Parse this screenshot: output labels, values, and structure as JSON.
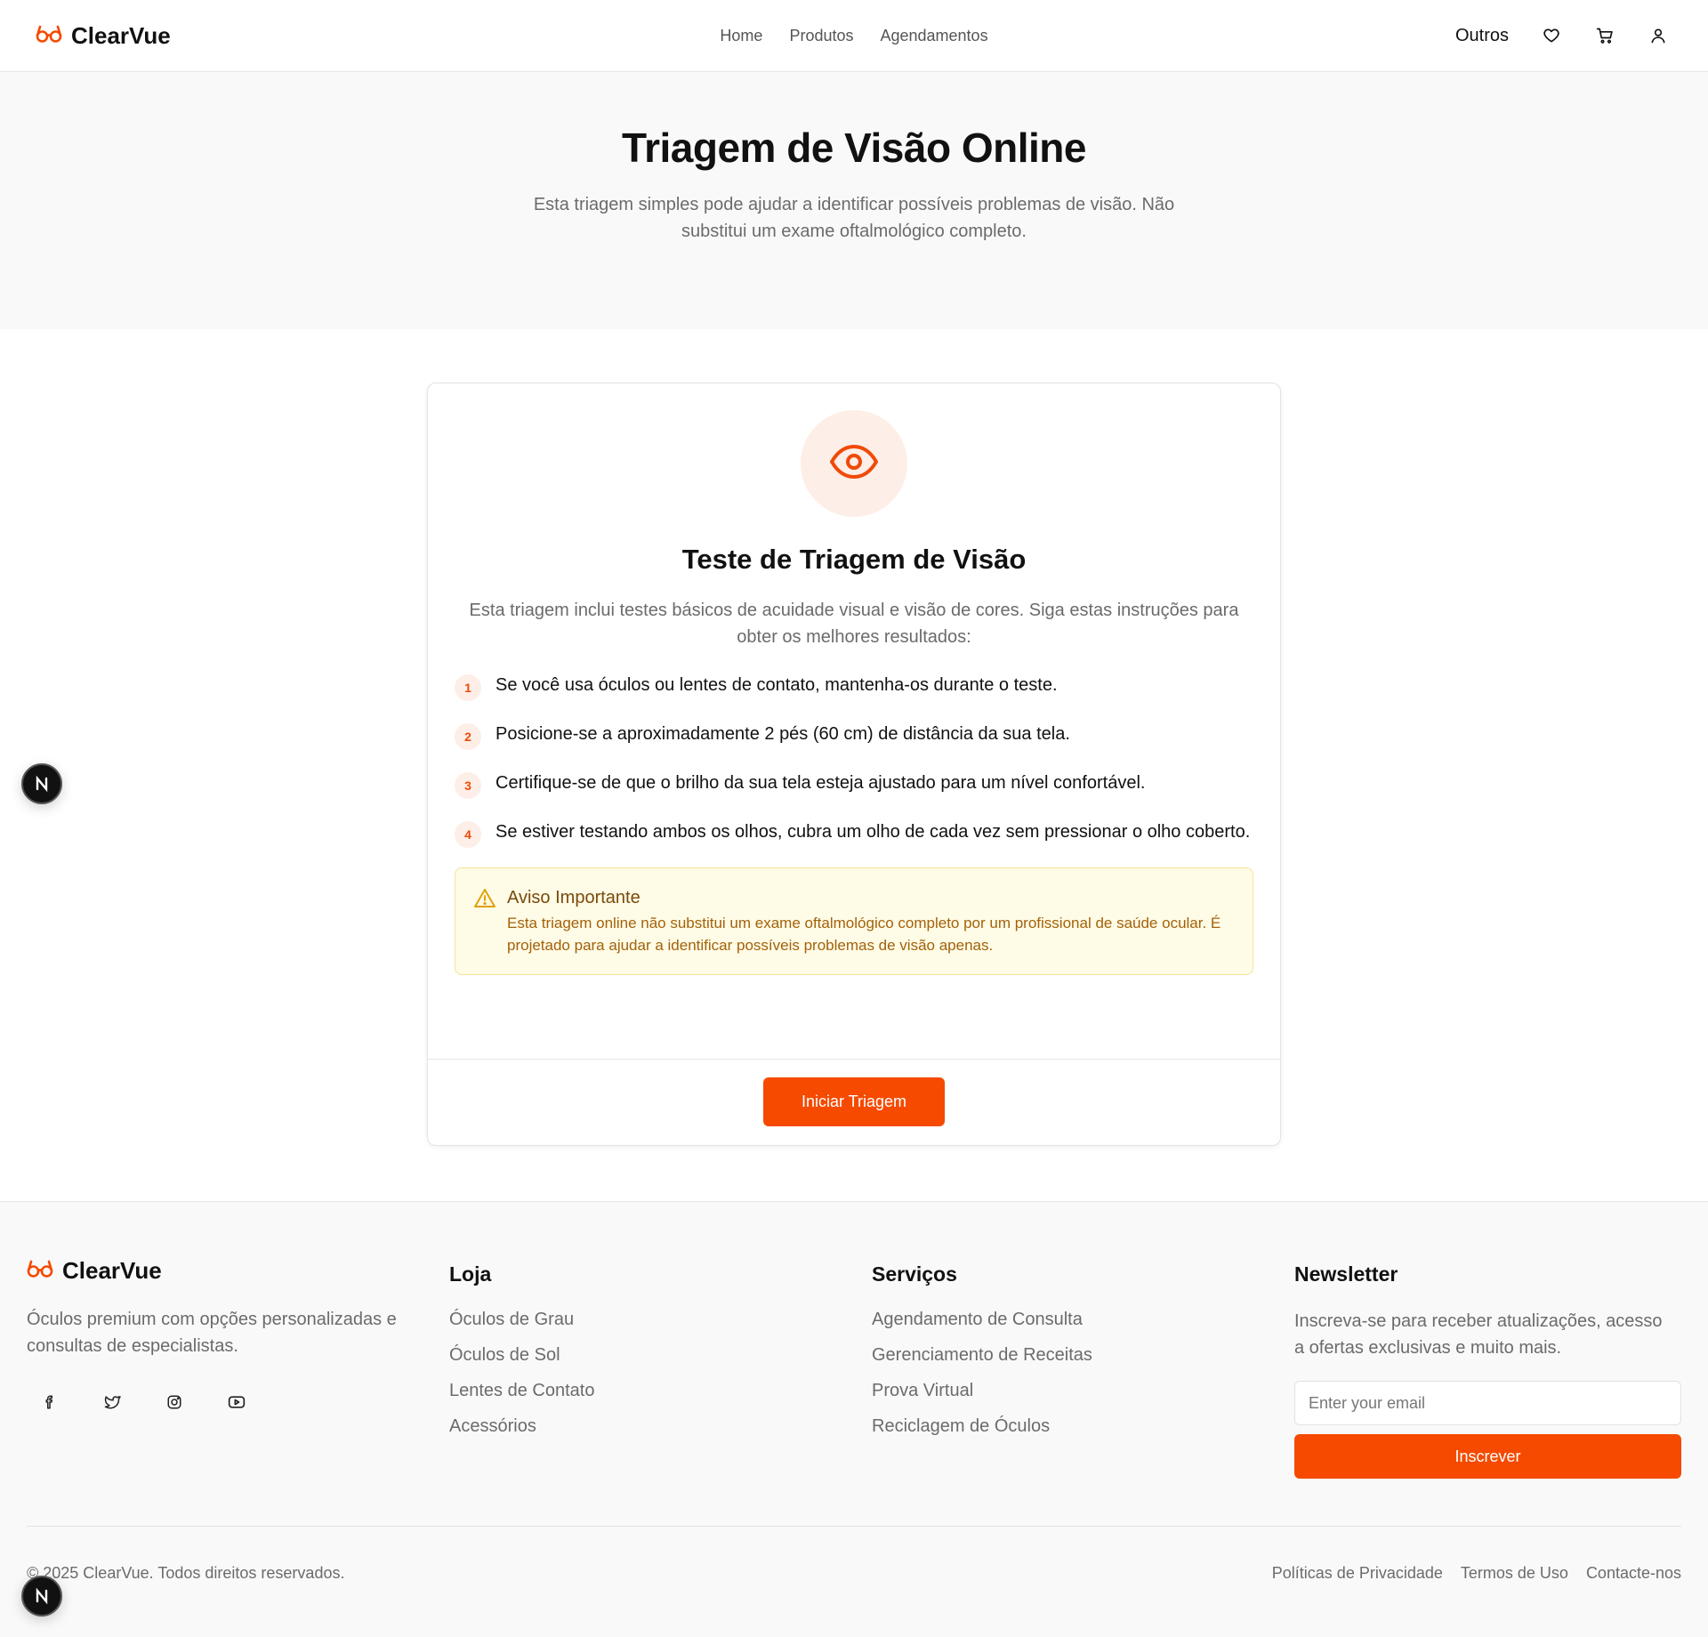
{
  "header": {
    "brand": "ClearVue",
    "nav": [
      "Home",
      "Produtos",
      "Agendamentos"
    ],
    "outros": "Outros"
  },
  "hero": {
    "title": "Triagem de Visão Online",
    "subtitle": "Esta triagem simples pode ajudar a identificar possíveis problemas de visão. Não substitui um exame oftalmológico completo."
  },
  "card": {
    "title": "Teste de Triagem de Visão",
    "intro": "Esta triagem inclui testes básicos de acuidade visual e visão de cores. Siga estas instruções para obter os melhores resultados:",
    "steps": [
      {
        "num": "1",
        "text": "Se você usa óculos ou lentes de contato, mantenha-os durante o teste."
      },
      {
        "num": "2",
        "text": "Posicione-se a aproximadamente 2 pés (60 cm) de distância da sua tela."
      },
      {
        "num": "3",
        "text": "Certifique-se de que o brilho da sua tela esteja ajustado para um nível confortável."
      },
      {
        "num": "4",
        "text": "Se estiver testando ambos os olhos, cubra um olho de cada vez sem pressionar o olho coberto."
      }
    ],
    "warning": {
      "title": "Aviso Importante",
      "text": "Esta triagem online não substitui um exame oftalmológico completo por um profissional de saúde ocular. É projetado para ajudar a identificar possíveis problemas de visão apenas."
    },
    "start_button": "Iniciar Triagem"
  },
  "footer": {
    "brand": "ClearVue",
    "description": "Óculos premium com opções personalizadas e consultas de especialistas.",
    "loja": {
      "title": "Loja",
      "links": [
        "Óculos de Grau",
        "Óculos de Sol",
        "Lentes de Contato",
        "Acessórios"
      ]
    },
    "servicos": {
      "title": "Serviços",
      "links": [
        "Agendamento de Consulta",
        "Gerenciamento de Receitas",
        "Prova Virtual",
        "Reciclagem de Óculos"
      ]
    },
    "newsletter": {
      "title": "Newsletter",
      "text": "Inscreva-se para receber atualizações, acesso a ofertas exclusivas e muito mais.",
      "placeholder": "Enter your email",
      "button": "Inscrever"
    },
    "copyright": "© 2025 ClearVue. Todos direitos reservados.",
    "legal": [
      "Políticas de Privacidade",
      "Termos de Uso",
      "Contacte-nos"
    ]
  },
  "badges": {
    "letter": "N"
  },
  "colors": {
    "accent": "#f54a00",
    "accent_soft": "#fdeee7",
    "warning_bg": "#fefbe6",
    "warning_text": "#a3620a"
  },
  "icons": [
    "glasses-icon",
    "heart-icon",
    "cart-icon",
    "user-icon",
    "eye-icon",
    "warning-icon",
    "facebook-icon",
    "twitter-icon",
    "instagram-icon",
    "youtube-icon"
  ]
}
